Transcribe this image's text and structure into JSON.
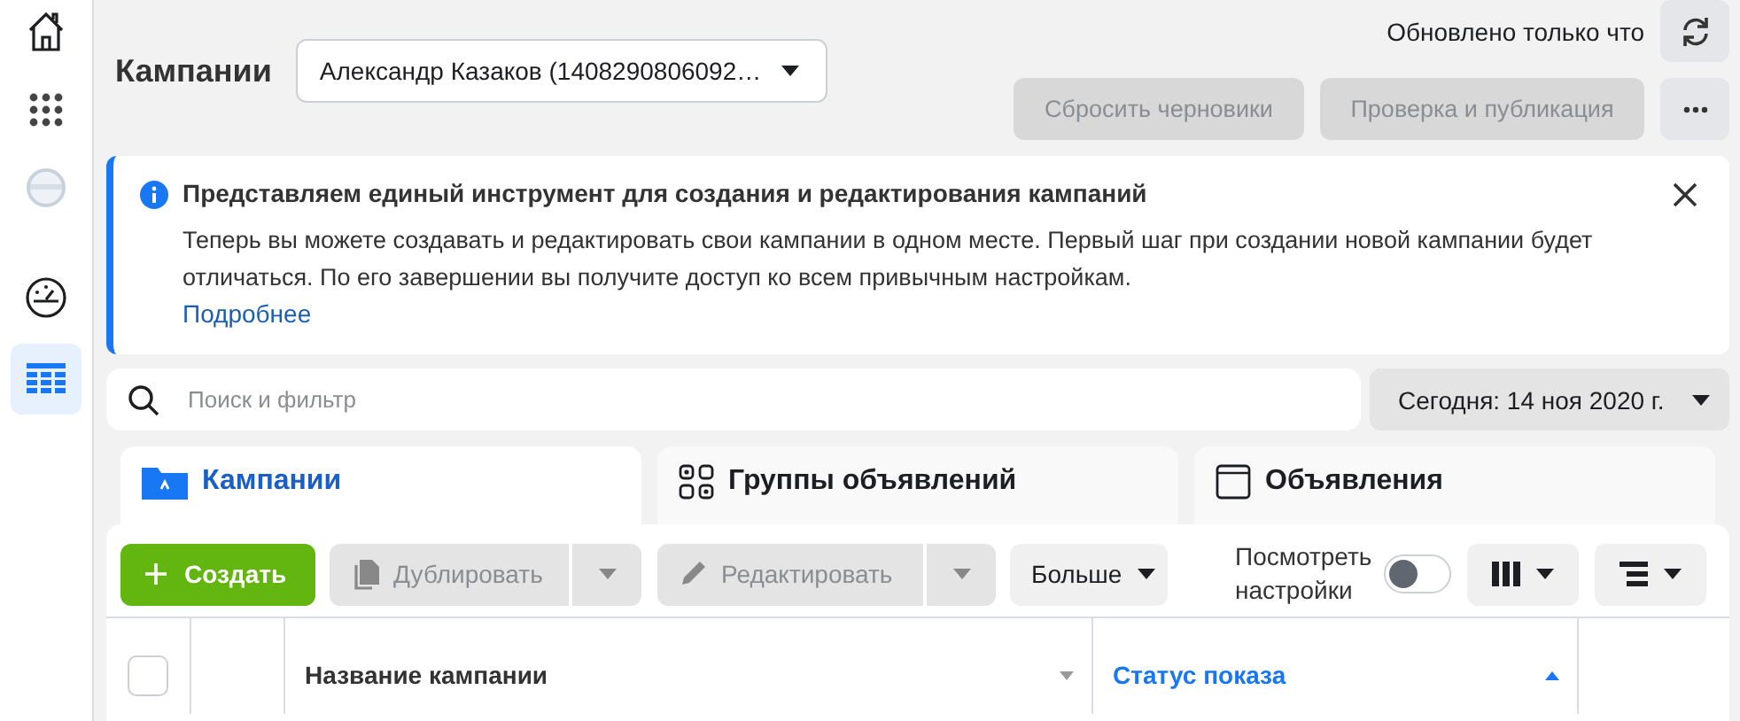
{
  "sidebar": {
    "items": [
      {
        "kind": "home",
        "selected": false
      },
      {
        "kind": "apps",
        "selected": false
      },
      {
        "kind": "avatar",
        "selected": false
      },
      {
        "kind": "gauge",
        "selected": false
      },
      {
        "kind": "table",
        "selected": true
      }
    ]
  },
  "header": {
    "title": "Кампании",
    "account": "Александр Казаков (1408290806092…",
    "updated": "Обновлено только что",
    "actions": [
      {
        "label": "Сбросить черновики",
        "disabled": true
      },
      {
        "label": "Проверка и публикация",
        "disabled": true
      }
    ]
  },
  "banner": {
    "title": "Представляем единый инструмент для создания и редактирования кампаний",
    "text": "Теперь вы можете создавать и редактировать свои кампании в одном месте. Первый шаг при создании новой кампании будет отличаться. По его завершении вы получите доступ ко всем привычным настройкам.",
    "link": "Подробнее"
  },
  "search": {
    "placeholder": "Поиск и фильтр"
  },
  "date_range": "Сегодня: 14 ноя 2020 г.",
  "tabs": [
    {
      "label": "Кампании",
      "kind": "campaigns",
      "selected": true
    },
    {
      "label": "Группы объявлений",
      "kind": "adsets",
      "selected": false
    },
    {
      "label": "Объявления",
      "kind": "ads",
      "selected": false
    }
  ],
  "toolbar": {
    "create": "Создать",
    "buttons": [
      {
        "label": "Дублировать",
        "kind": "duplicate",
        "disabled": true
      },
      {
        "label": "Редактировать",
        "kind": "edit",
        "disabled": true
      }
    ],
    "more": "Больше",
    "view_settings": {
      "label": "Посмотреть настройки",
      "on": false
    }
  },
  "table": {
    "select_all_checked": false,
    "columns": [
      {
        "label": "Название кампании",
        "sorted": false
      },
      {
        "label": "Статус показа",
        "sorted": true
      }
    ]
  }
}
